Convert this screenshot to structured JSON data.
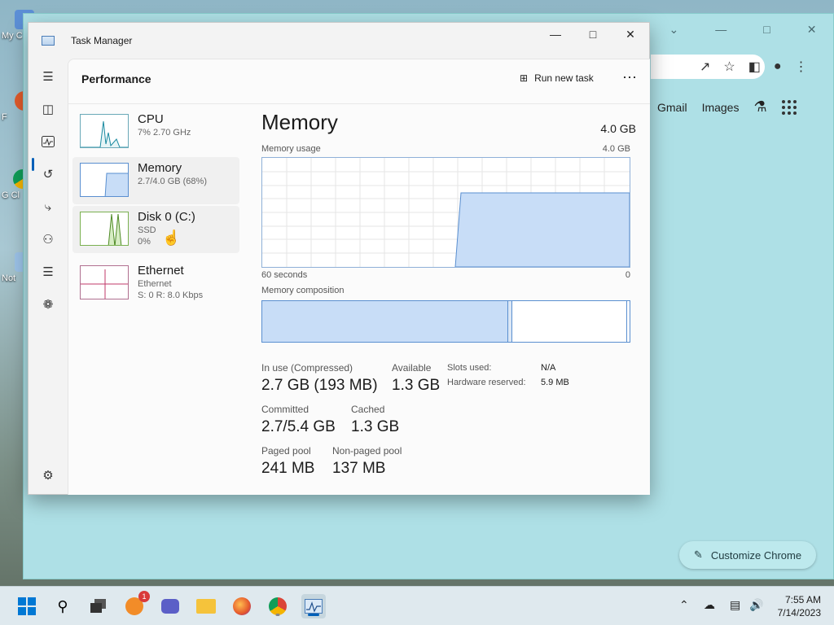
{
  "desktop": {
    "icons": [
      {
        "label": "My C"
      },
      {
        "label": "F"
      },
      {
        "label": "G\nCl"
      },
      {
        "label": "Not"
      }
    ]
  },
  "chrome": {
    "links": {
      "gmail": "Gmail",
      "images": "Images"
    },
    "customize_label": "Customize Chrome"
  },
  "task_manager": {
    "title": "Task Manager",
    "page_title": "Performance",
    "run_new_task": "Run new task",
    "more": "⋯",
    "resources": [
      {
        "name": "CPU",
        "sub1": "7%  2.70 GHz",
        "sub2": ""
      },
      {
        "name": "Memory",
        "sub1": "2.7/4.0 GB (68%)",
        "sub2": ""
      },
      {
        "name": "Disk 0 (C:)",
        "sub1": "SSD",
        "sub2": "0%"
      },
      {
        "name": "Ethernet",
        "sub1": "Ethernet",
        "sub2": "S: 0  R: 8.0 Kbps"
      }
    ],
    "detail": {
      "title": "Memory",
      "total": "4.0 GB",
      "usage_label": "Memory usage",
      "usage_max": "4.0 GB",
      "axis_left": "60 seconds",
      "axis_right": "0",
      "composition_label": "Memory composition",
      "in_use_label": "In use (Compressed)",
      "in_use_value": "2.7 GB (193 MB)",
      "available_label": "Available",
      "available_value": "1.3 GB",
      "committed_label": "Committed",
      "committed_value": "2.7/5.4 GB",
      "cached_label": "Cached",
      "cached_value": "1.3 GB",
      "paged_label": "Paged pool",
      "paged_value": "241 MB",
      "nonpaged_label": "Non-paged pool",
      "nonpaged_value": "137 MB",
      "slots_label": "Slots used:",
      "slots_value": "N/A",
      "hw_label": "Hardware reserved:",
      "hw_value": "5.9 MB",
      "usage_fraction": 0.68
    }
  },
  "taskbar": {
    "notification_badge": "1",
    "time": "7:55 AM",
    "date": "7/14/2023"
  },
  "colors": {
    "accent": "#005fb8",
    "memory_fill": "#c8ddf7",
    "memory_line": "#5a8fd0"
  }
}
